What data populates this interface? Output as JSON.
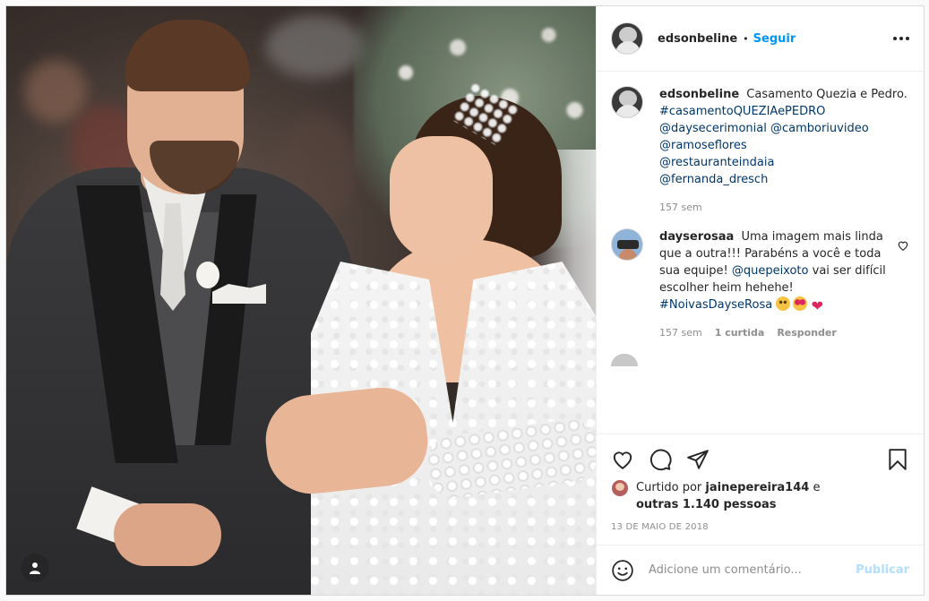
{
  "post": {
    "author": "edsonbeline",
    "separator": "•",
    "follow_label": "Seguir",
    "caption": {
      "username": "edsonbeline",
      "text": "Casamento Quezia e Pedro.",
      "links": [
        "#casamentoQUEZIAePEDRO",
        "@daysecerimonial @camboriuvideo",
        "@ramoseflores",
        "@restauranteindaia",
        "@fernanda_dresch"
      ],
      "time": "157 sem"
    },
    "comments": [
      {
        "username": "dayserosaa",
        "text": "Uma imagem mais linda que a outra!!! Parabéns a você e toda sua equipe!",
        "mention": "@quepeixoto",
        "text2": "vai ser difícil escolher heim hehehe!",
        "hashtag": "#NoivasDayseRosa",
        "emojis": [
          "smiling-face-icon",
          "heart-eyes-icon",
          "heart-icon"
        ],
        "time": "157 sem",
        "likes": "1 curtida",
        "reply_label": "Responder"
      }
    ],
    "liked_by": {
      "prefix": "Curtido por",
      "user": "jainepereira144",
      "joiner": "e",
      "others": "outras 1.140 pessoas"
    },
    "date": "13 DE MAIO DE 2018",
    "comment_input": {
      "placeholder": "Adicione um comentário...",
      "publish_label": "Publicar"
    },
    "colors": {
      "link": "#00376b",
      "accent": "#0095f6",
      "publish_disabled": "#b2dffc"
    }
  }
}
